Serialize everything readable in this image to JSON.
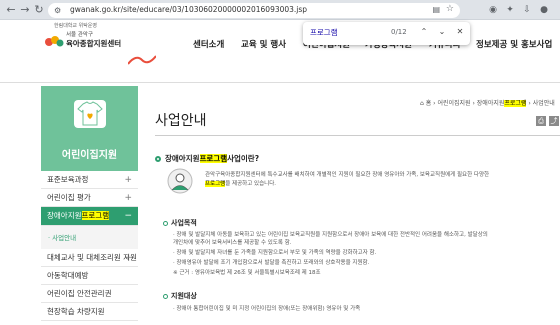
{
  "browser": {
    "url": "gwanak.go.kr/site/educare/03/10306020000002016093003.jsp",
    "find_query": "프로그램",
    "find_count": "0/12"
  },
  "header": {
    "logo_sub": "한림대학교 위탁운영",
    "logo_line1": "서울 관악구",
    "logo_line2": "육아종합지원센터",
    "nav": [
      "센터소개",
      "교육 및 행사",
      "어린이집지원",
      "가정양육지원",
      "커뮤니티",
      "정보제공 및 홍보사업"
    ]
  },
  "sidebar": {
    "title": "어린이집지원",
    "items": [
      {
        "label": "표준보육과정",
        "pm": "+"
      },
      {
        "label": "어린이집 평가",
        "pm": "+"
      },
      {
        "label_pre": "장애아지원",
        "label_hl": "프로그램",
        "pm": "−"
      }
    ],
    "sub_item": "· 사업안내",
    "items2": [
      {
        "label": "대체교사 및 대체조리원 지원",
        "pm": "+"
      },
      {
        "label": "아동학대예방"
      },
      {
        "label": "어린이집 안전관리권"
      },
      {
        "label": "현장학습 차량지원"
      }
    ]
  },
  "main": {
    "breadcrumb_pre": "⌂ 홈 › 어린이집지원 › 장애아지원",
    "breadcrumb_hl": "프로그램",
    "breadcrumb_post": " › 사업안내",
    "title": "사업안내",
    "question_pre": "장애아지원",
    "question_hl": "프로그램",
    "question_post": "사업이란?",
    "intro_line1": "관악구육아종합지원센터에 특수교사를 배치하여 개별적인 지원이 필요한 장애 영유아와 가족, 보육교직원에게 필요한 다양한",
    "intro_hl": "프로그램",
    "intro_post": "을 제공하고 있습니다.",
    "sec1_title": "사업목적",
    "sec1_bullets": [
      "· 장애 및 발달지체 아동을 보육하고 있는 어린이집 보육교직원을 지원함으로서 장애아 보육에 대한 전반적인 어려움을 해소하고, 발달상의",
      "  개인차에 맞추어 보육서비스를 제공할 수 있도록 함.",
      "· 장애 및 발달지체 자녀를 둔 가족을 지원함으로서 부모 및 가족의 역량을 강화하고자 함.",
      "· 장애영유아 발달에 조기 개입함으로서 발달을 촉진하고 또래와의 상호작용을 지원함.",
      "  ※ 근거 : 영유아보육법 제 26조 및 서울특별시보육조례 제 18조"
    ],
    "sec2_title": "지원대상",
    "sec2_bullets": [
      "· 장애아 통합어린이집 및 미 지정 어린이집의 장애(또는 장애위험) 영유아 및 가족"
    ]
  }
}
